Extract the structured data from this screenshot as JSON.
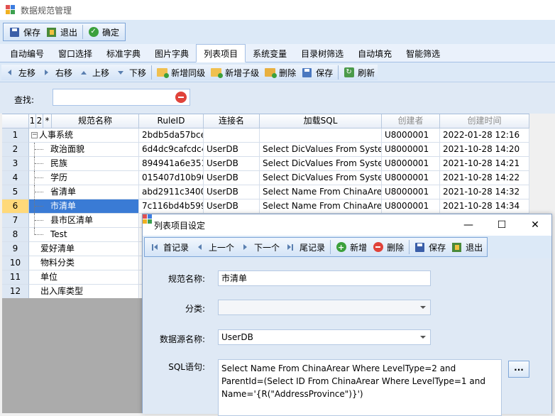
{
  "app": {
    "title": "数据规范管理"
  },
  "toolbar1": {
    "save": "保存",
    "exit": "退出",
    "confirm": "确定"
  },
  "tabs": [
    "自动编号",
    "窗口选择",
    "标准字典",
    "图片字典",
    "列表项目",
    "系统变量",
    "目录树筛选",
    "自动填充",
    "智能筛选"
  ],
  "active_tab": "列表项目",
  "toolbar2": {
    "move_left": "左移",
    "move_right": "右移",
    "move_up": "上移",
    "move_down": "下移",
    "add_sibling": "新增同级",
    "add_child": "新增子级",
    "delete": "删除",
    "save": "保存",
    "refresh": "刷新"
  },
  "search": {
    "label": "查找:",
    "value": ""
  },
  "grid": {
    "headers": {
      "levels": [
        "1",
        "2",
        "*"
      ],
      "name": "规范名称",
      "rule_id": "RuleID",
      "conn": "连接名",
      "sql": "加载SQL",
      "creator": "创建者",
      "created": "创建时间"
    },
    "rows": [
      {
        "no": "1",
        "name": "人事系统",
        "rule_id": "2bdb5da57bce",
        "conn": "",
        "sql": "",
        "creator": "U8000001",
        "created": "2022-01-28 12:16"
      },
      {
        "no": "2",
        "name": "政治面貌",
        "rule_id": "6d4dc9cafcdc4",
        "conn": "UserDB",
        "sql": "Select DicValues From  Syste",
        "creator": "U8000001",
        "created": "2021-10-28 14:20"
      },
      {
        "no": "3",
        "name": "民族",
        "rule_id": "894941a6e351",
        "conn": "UserDB",
        "sql": "Select DicValues From  Syste",
        "creator": "U8000001",
        "created": "2021-10-28 14:21"
      },
      {
        "no": "4",
        "name": "学历",
        "rule_id": "015407d10b90",
        "conn": "UserDB",
        "sql": "Select DicValues From  Syste",
        "creator": "U8000001",
        "created": "2021-10-28 14:22"
      },
      {
        "no": "5",
        "name": "省清单",
        "rule_id": "abd2911c3400",
        "conn": "UserDB",
        "sql": "Select Name From  ChinaAre",
        "creator": "U8000001",
        "created": "2021-10-28 14:32"
      },
      {
        "no": "6",
        "name": "市清单",
        "rule_id": "7c116bd4b599",
        "conn": "UserDB",
        "sql": "Select Name From  ChinaAre",
        "creator": "U8000001",
        "created": "2021-10-28 14:34"
      },
      {
        "no": "7",
        "name": "县市区清单",
        "rule_id": "",
        "conn": "",
        "sql": "",
        "creator": "",
        "created": ""
      },
      {
        "no": "8",
        "name": "Test",
        "rule_id": "",
        "conn": "",
        "sql": "",
        "creator": "",
        "created": ""
      },
      {
        "no": "9",
        "name": "爱好清单",
        "rule_id": "",
        "conn": "",
        "sql": "",
        "creator": "",
        "created": ""
      },
      {
        "no": "10",
        "name": "物料分类",
        "rule_id": "",
        "conn": "",
        "sql": "",
        "creator": "",
        "created": ""
      },
      {
        "no": "11",
        "name": "单位",
        "rule_id": "",
        "conn": "",
        "sql": "",
        "creator": "",
        "created": ""
      },
      {
        "no": "12",
        "name": "出入库类型",
        "rule_id": "",
        "conn": "",
        "sql": "",
        "creator": "",
        "created": ""
      }
    ]
  },
  "dialog": {
    "title": "列表项目设定",
    "toolbar": {
      "first": "首记录",
      "prev": "上一个",
      "next": "下一个",
      "last": "尾记录",
      "add": "新增",
      "delete": "删除",
      "save": "保存",
      "exit": "退出"
    },
    "fields": {
      "name_label": "规范名称:",
      "name_value": "市清单",
      "category_label": "分类:",
      "category_value": "",
      "ds_label": "数据源名称:",
      "ds_value": "UserDB",
      "sql_label": "SQL语句:",
      "sql_value": "Select Name From  ChinaArear Where LevelType=2 and ParentId=(Select ID From  ChinaArear Where LevelType=1 and Name='{R(\"AddressProvince\")}')",
      "more": "..."
    }
  },
  "colors": {
    "selection": "#3a7bd5",
    "toolbar_bg": "#dce9f7",
    "form_bg": "#dfe9f5"
  }
}
